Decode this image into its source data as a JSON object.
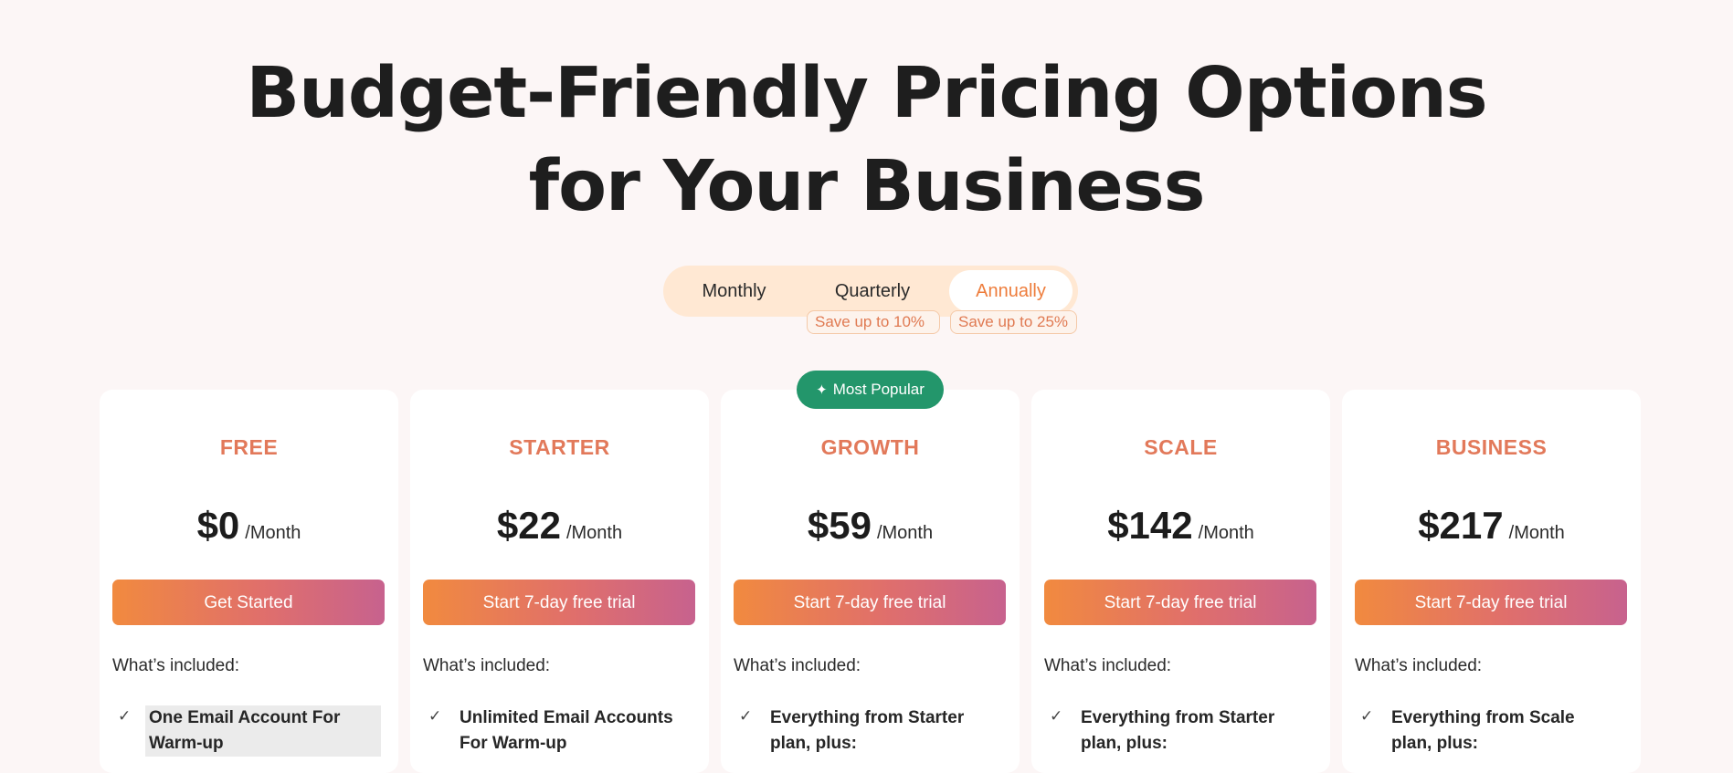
{
  "title": {
    "line1": "Budget-Friendly Pricing Options",
    "line2": "for Your Business"
  },
  "billing": {
    "options": [
      "Monthly",
      "Quarterly",
      "Annually"
    ],
    "selected": "Annually",
    "save_quarterly": "Save up to 10%",
    "save_annually": "Save up to 25%"
  },
  "popular_badge": "Most Popular",
  "included_label": "What’s included:",
  "plans": [
    {
      "name": "FREE",
      "price": "$0",
      "period": "/Month",
      "cta": "Get Started",
      "feature": "One Email Account For Warm-up"
    },
    {
      "name": "STARTER",
      "price": "$22",
      "period": "/Month",
      "cta": "Start 7-day free trial",
      "feature": "Unlimited Email Accounts For Warm-up"
    },
    {
      "name": "GROWTH",
      "price": "$59",
      "period": "/Month",
      "cta": "Start 7-day free trial",
      "feature": "Everything from Starter plan, plus:"
    },
    {
      "name": "SCALE",
      "price": "$142",
      "period": "/Month",
      "cta": "Start 7-day free trial",
      "feature": "Everything from Starter plan, plus:"
    },
    {
      "name": "BUSINESS",
      "price": "$217",
      "period": "/Month",
      "cta": "Start 7-day free trial",
      "feature": "Everything from Scale plan, plus:"
    }
  ],
  "colors": {
    "accent_orange": "#f18a3f",
    "accent_pink": "#c7628e",
    "popular_green": "#23966b",
    "toggle_bg": "#ffe8d3"
  },
  "icons": {
    "check": "check-icon",
    "sparkle": "sparkle-icon"
  }
}
